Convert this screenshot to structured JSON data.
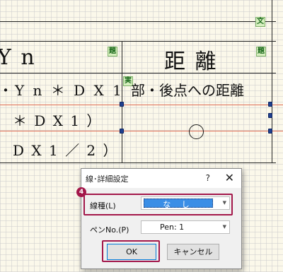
{
  "canvas": {
    "tag_bun": "文",
    "tag_dai_left": "題",
    "tag_dai_right": "題",
    "tag_jitsu": "実",
    "cell_yn": "Y n",
    "cell_kyori": "距 離",
    "cell_formula": "・Y n ＊ D X 1",
    "cell_kouten": "部・後点への距離",
    "cell_row3": "＊  D X 1 ）",
    "cell_row4": "D X 1 ／ 2 ）"
  },
  "dialog": {
    "title": "線･詳細設定",
    "help": "?",
    "close": "✕",
    "line_type_label": "線種(L)",
    "line_type_value": "な し",
    "pen_label": "ペンNo.(P)",
    "pen_value": "Pen: 1",
    "ok": "OK",
    "cancel": "キャンセル"
  },
  "annotation": {
    "step": "4",
    "highlight_color": "#a3174a"
  }
}
